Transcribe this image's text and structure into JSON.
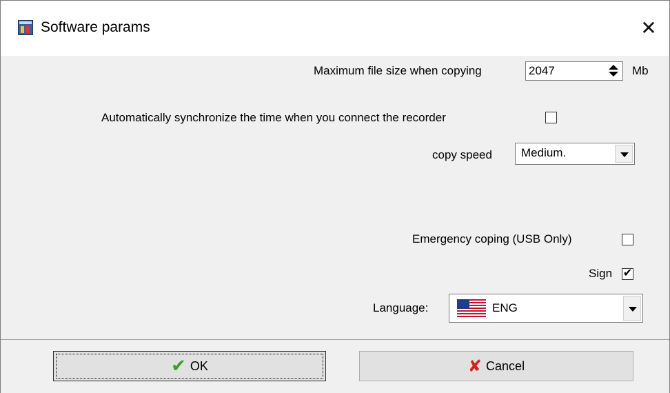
{
  "window": {
    "title": "Software params",
    "close_glyph": "✕"
  },
  "params": {
    "max_file_size_label": "Maximum file size when copying",
    "max_file_size_value": "2047",
    "max_file_size_unit": "Mb",
    "auto_sync_label": "Automatically synchronize the time when you connect the recorder",
    "auto_sync_checked": false,
    "copy_speed_label": "copy speed",
    "copy_speed_value": "Medium.",
    "emergency_label": "Emergency coping (USB Only)",
    "emergency_checked": false,
    "sign_label": "Sign",
    "sign_checked": true,
    "sign_check_glyph": "✔",
    "language_label": "Language:",
    "language_value": "ENG"
  },
  "buttons": {
    "ok_label": "OK",
    "ok_icon": "✔",
    "cancel_label": "Cancel",
    "cancel_icon": "✘"
  },
  "colors": {
    "dialog_bg": "#f0f0f0",
    "ok_icon": "#3da11d",
    "cancel_icon": "#d0241c"
  }
}
